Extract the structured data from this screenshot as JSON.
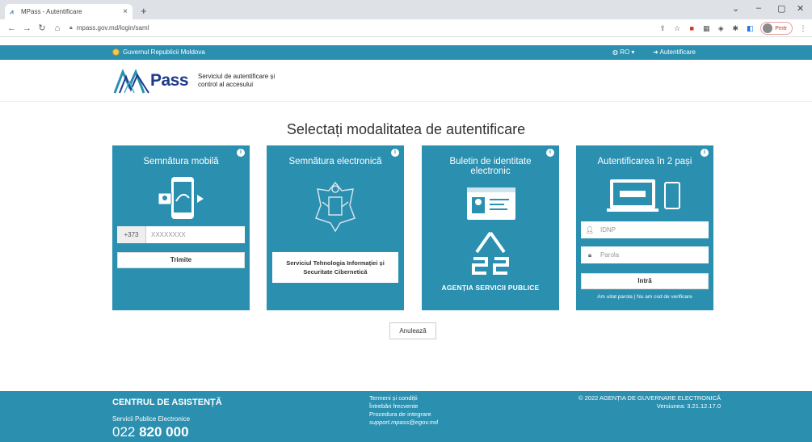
{
  "browser": {
    "tab_title": "MPass - Autentificare",
    "tab_close": "×",
    "new_tab": "+",
    "url": "mpass.gov.md/login/saml",
    "profile_label": "Pmtr"
  },
  "govbar": {
    "name": "Guvernul Republicii Moldova",
    "lang": "RO ▾",
    "login": "Autentificare"
  },
  "header": {
    "logo_pass": "Pass",
    "tagline": "Serviciul de autentificare și control al accesului"
  },
  "page_title": "Selectați modalitatea de autentificare",
  "cards": {
    "mobile": {
      "title": "Semnătura mobilă",
      "prefix": "+373",
      "placeholder": "XXXXXXXX",
      "button": "Trimite"
    },
    "electronic": {
      "title": "Semnătura electronică",
      "provider": "Serviciul Tehnologia Informației și Securitate Cibernetică"
    },
    "idcard": {
      "title": "Buletin de identitate electronic",
      "agency": "AGENȚIA SERVICII PUBLICE"
    },
    "twofa": {
      "title": "Autentificarea în 2 pași",
      "idnp_placeholder": "IDNP",
      "password_placeholder": "Parola",
      "button": "Intră",
      "links": "Am uitat parola | Nu am cod de verificare"
    }
  },
  "cancel_label": "Anulează",
  "footer": {
    "help_title": "CENTRUL DE ASISTENȚĂ",
    "help_sub": "Servicii Publice Electronice",
    "phone_prefix": "022 ",
    "phone_main": "820 000",
    "links": [
      "Termeni și condiții",
      "Întrebări frecvente",
      "Procedura de integrare",
      "support.mpass@egov.md"
    ],
    "copyright": "© 2022 AGENȚIA DE GUVERNARE ELECTRONICĂ",
    "version": "Versiunea: 3.21.12.17.0"
  },
  "colors": {
    "primary": "#2b8fb0",
    "logo_blue": "#1e3a8a"
  }
}
